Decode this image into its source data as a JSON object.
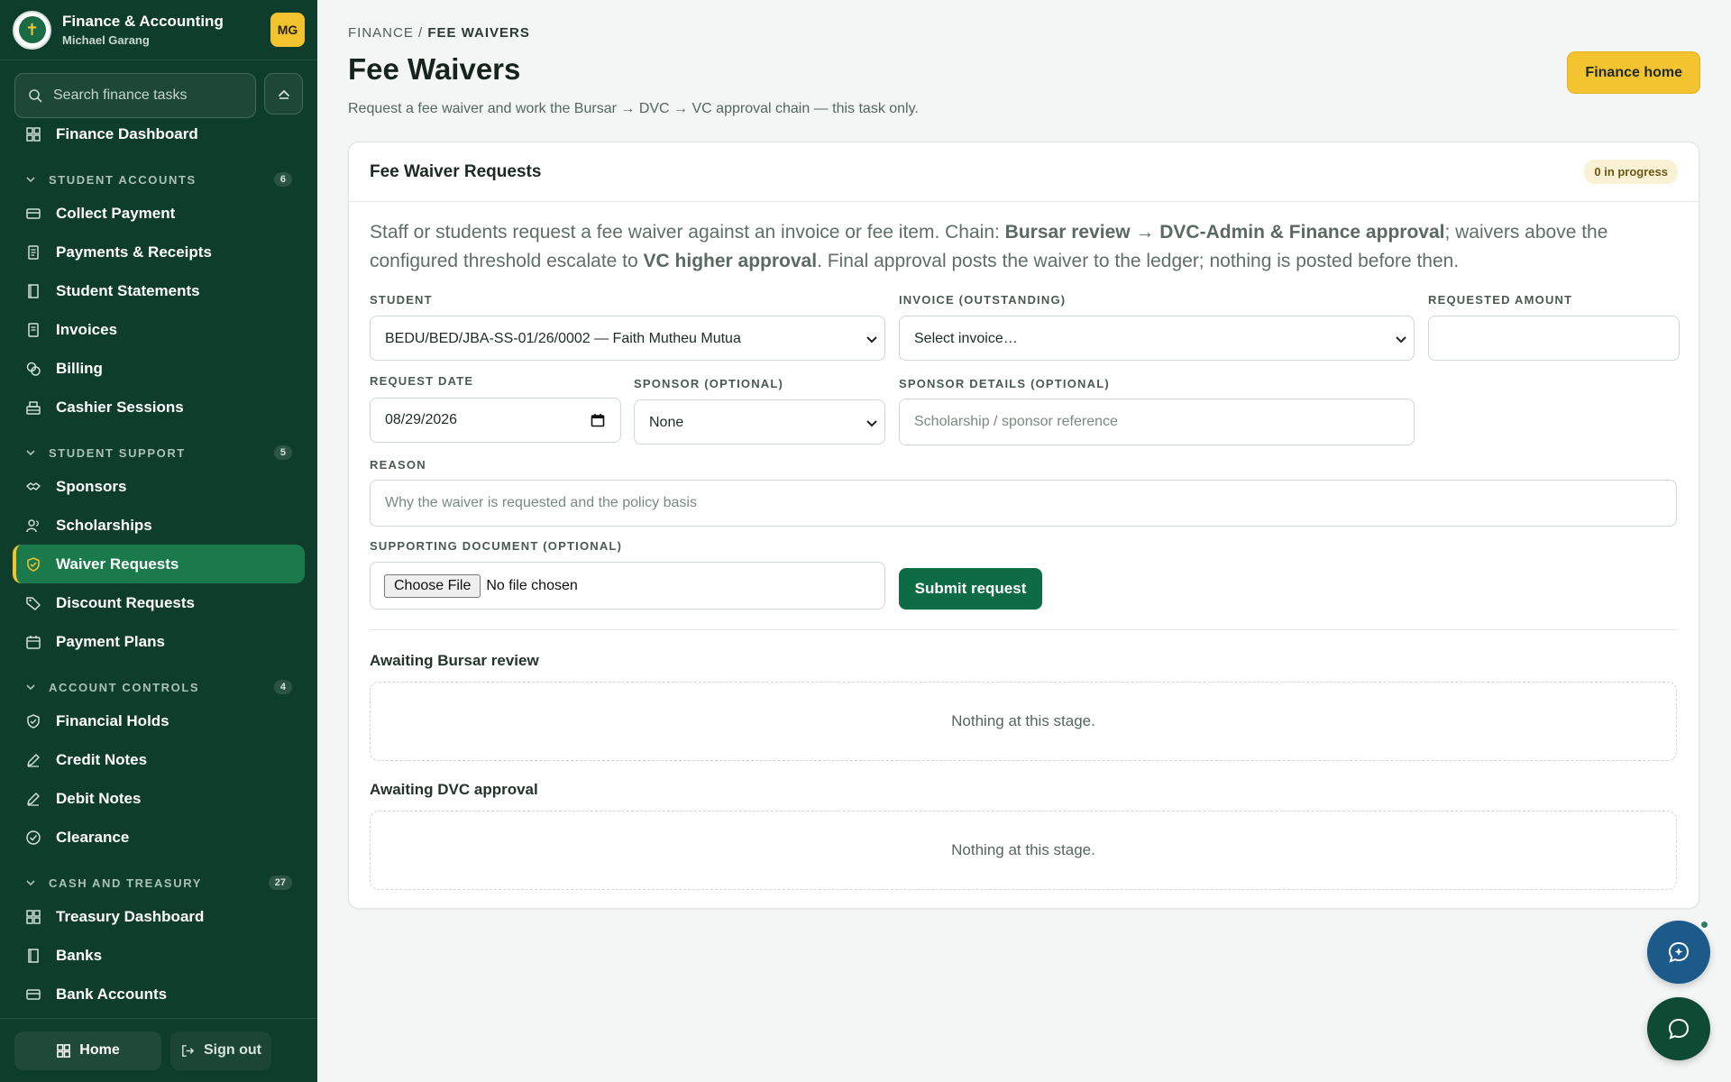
{
  "sidebar": {
    "app_title": "Finance & Accounting",
    "user_name": "Michael Garang",
    "avatar_initials": "MG",
    "search_placeholder": "Search finance tasks",
    "top_item": "Finance Dashboard",
    "sections": [
      {
        "label": "STUDENT ACCOUNTS",
        "count": "6"
      },
      {
        "label": "STUDENT SUPPORT",
        "count": "5"
      },
      {
        "label": "ACCOUNT CONTROLS",
        "count": "4"
      },
      {
        "label": "CASH AND TREASURY",
        "count": "27"
      }
    ],
    "items": {
      "collect_payment": "Collect Payment",
      "payments_receipts": "Payments & Receipts",
      "student_statements": "Student Statements",
      "invoices": "Invoices",
      "billing": "Billing",
      "cashier_sessions": "Cashier Sessions",
      "sponsors": "Sponsors",
      "scholarships": "Scholarships",
      "waiver_requests": "Waiver Requests",
      "discount_requests": "Discount Requests",
      "payment_plans": "Payment Plans",
      "financial_holds": "Financial Holds",
      "credit_notes": "Credit Notes",
      "debit_notes": "Debit Notes",
      "clearance": "Clearance",
      "treasury_dashboard": "Treasury Dashboard",
      "banks": "Banks",
      "bank_accounts": "Bank Accounts"
    },
    "footer": {
      "home": "Home",
      "sign_out": "Sign out"
    }
  },
  "header": {
    "breadcrumb_root": "FINANCE",
    "breadcrumb_sep": "/",
    "breadcrumb_current": "FEE WAIVERS",
    "title": "Fee Waivers",
    "subtitle": "Request a fee waiver and work the Bursar → DVC → VC approval chain — this task only.",
    "finance_home": "Finance home"
  },
  "card": {
    "title": "Fee Waiver Requests",
    "badge": "0 in progress",
    "intro": {
      "p1": "Staff or students request a fee waiver against an invoice or fee item. Chain: ",
      "b1": "Bursar review → DVC-Admin & Finance approval",
      "p2": "; waivers above the configured threshold escalate to ",
      "b2": "VC higher approval",
      "p3": ". Final approval posts the waiver to the ledger; nothing is posted before then."
    },
    "form": {
      "student_label": "STUDENT",
      "student_value": "BEDU/BED/JBA-SS-01/26/0002 — Faith Mutheu Mutua",
      "invoice_label": "INVOICE (OUTSTANDING)",
      "invoice_value": "Select invoice…",
      "amount_label": "REQUESTED AMOUNT",
      "amount_value": "",
      "date_label": "REQUEST DATE",
      "date_value": "08/29/2026",
      "sponsor_label": "SPONSOR (OPTIONAL)",
      "sponsor_value": "None",
      "sponsor_details_label": "SPONSOR DETAILS (OPTIONAL)",
      "sponsor_details_placeholder": "Scholarship / sponsor reference",
      "reason_label": "REASON",
      "reason_placeholder": "Why the waiver is requested and the policy basis",
      "document_label": "SUPPORTING DOCUMENT (OPTIONAL)",
      "choose_file": "Choose File",
      "no_file": "No file chosen",
      "submit": "Submit request"
    },
    "stages": [
      {
        "title": "Awaiting Bursar review",
        "empty": "Nothing at this stage."
      },
      {
        "title": "Awaiting DVC approval",
        "empty": "Nothing at this stage."
      }
    ]
  },
  "colors": {
    "sidebar_bg": "#0f3d2c",
    "active_item": "#1a7a4c",
    "accent_yellow": "#f4c430",
    "primary_green": "#0d6b45"
  }
}
